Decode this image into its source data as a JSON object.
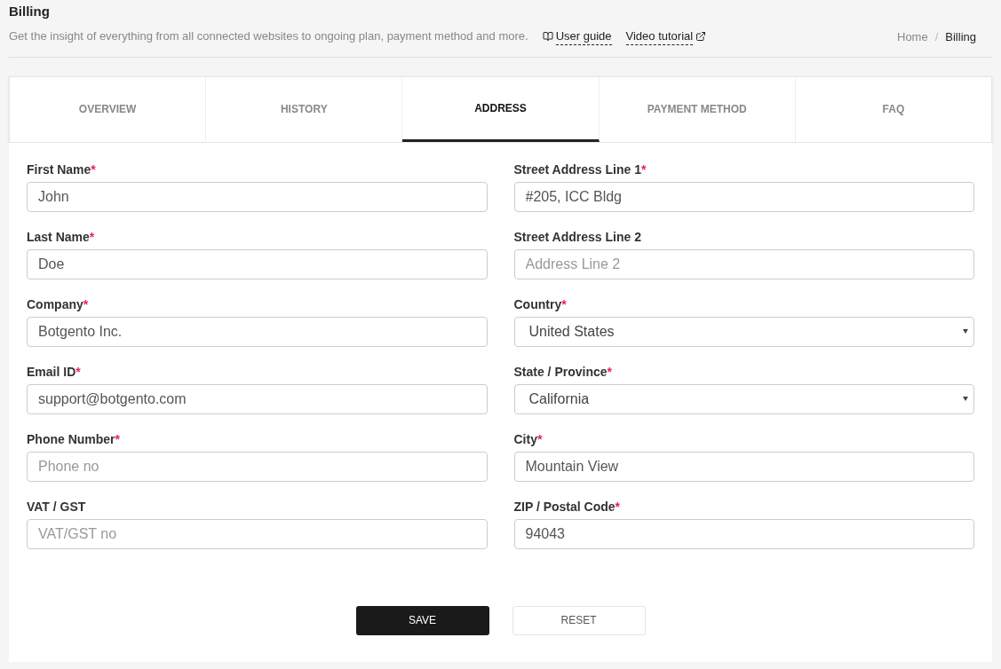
{
  "header": {
    "title": "Billing",
    "subtitle": "Get the insight of everything from all connected websites to ongoing plan, payment method and more.",
    "links": [
      {
        "label": "User guide",
        "kind": "guide"
      },
      {
        "label": "Video tutorial",
        "kind": "external"
      }
    ]
  },
  "breadcrumb": {
    "items": [
      "Home",
      "Billing"
    ],
    "separator": "/"
  },
  "tabs": [
    {
      "label": "OVERVIEW",
      "selected": false
    },
    {
      "label": "HISTORY",
      "selected": false
    },
    {
      "label": "ADDRESS",
      "selected": true
    },
    {
      "label": "PAYMENT METHOD",
      "selected": false
    },
    {
      "label": "FAQ",
      "selected": false
    }
  ],
  "fields": [
    {
      "label": "First Name",
      "required_mark": "*",
      "kind": "input",
      "value": "John"
    },
    {
      "label": "Street Address Line 1",
      "required_mark": "*",
      "kind": "input",
      "value": "#205, ICC Bldg"
    },
    {
      "label": "Last Name",
      "required_mark": "*",
      "kind": "input",
      "value": "Doe"
    },
    {
      "label": "Street Address Line 2",
      "kind": "input",
      "placeholder": "Address Line 2"
    },
    {
      "label": "Company",
      "required_mark": "*",
      "kind": "input",
      "value": "Botgento Inc."
    },
    {
      "label": "Country",
      "required_mark": "*",
      "kind": "select",
      "value": "United States"
    },
    {
      "label": "Email ID",
      "required_mark": "*",
      "kind": "input",
      "value": "support@botgento.com"
    },
    {
      "label": "State / Province",
      "required_mark": "*",
      "kind": "select",
      "value": "California"
    },
    {
      "label": "Phone Number",
      "required_mark": "*",
      "kind": "input",
      "placeholder": "Phone no"
    },
    {
      "label": "City",
      "required_mark": "*",
      "kind": "input",
      "value": "Mountain View"
    },
    {
      "label": "VAT / GST",
      "kind": "input",
      "placeholder": "VAT/GST no"
    },
    {
      "label": "ZIP / Postal Code",
      "required_mark": "*",
      "kind": "input",
      "value": "94043"
    }
  ],
  "buttons": [
    {
      "label": "SAVE",
      "kind": "primary"
    },
    {
      "label": "RESET",
      "kind": "secondary"
    }
  ]
}
